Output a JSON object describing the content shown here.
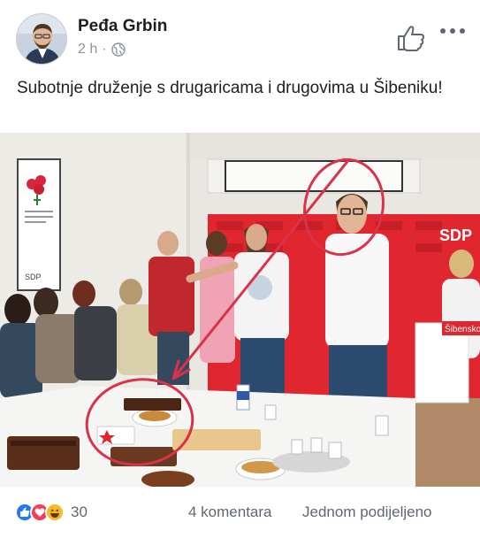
{
  "post": {
    "author": "Peđa Grbin",
    "time": "2 h",
    "separator": "·",
    "text": "Subotnje druženje s drugaricama i drugovima u Šibeniku!"
  },
  "photo": {
    "banner_text": "SDP",
    "banner_text_2": "Šibenskog",
    "poster_caption": "SDP"
  },
  "stats": {
    "reactions_count": "30",
    "comments": "4 komentara",
    "shares": "Jednom podijeljeno"
  },
  "colors": {
    "text": "#1c1e21",
    "secondary": "#606770",
    "like_blue": "#2078f4",
    "love_red": "#f33e58",
    "haha_yellow": "#f7b928",
    "sdp_red": "#e0262f",
    "annotation_red": "#d8334a"
  },
  "icons": [
    "globe-icon",
    "like-outline-icon",
    "more-dots-icon",
    "like-reaction-icon",
    "love-reaction-icon",
    "haha-reaction-icon"
  ]
}
